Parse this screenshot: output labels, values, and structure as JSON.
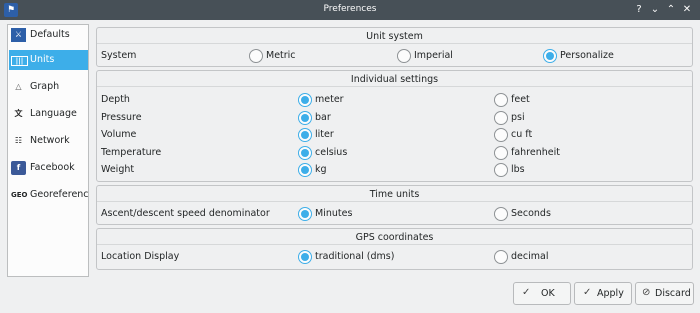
{
  "window": {
    "title": "Preferences",
    "icon": "subsurface-app-icon",
    "controls": [
      "help-icon",
      "minimize-icon",
      "maximize-icon",
      "close-icon"
    ]
  },
  "sidebar": {
    "selected": "Units",
    "items": [
      {
        "label": "Defaults",
        "icon": "diver-icon"
      },
      {
        "label": "Units",
        "icon": "ruler-icon"
      },
      {
        "label": "Graph",
        "icon": "graph-icon"
      },
      {
        "label": "Language",
        "icon": "language-icon"
      },
      {
        "label": "Network",
        "icon": "network-icon"
      },
      {
        "label": "Facebook",
        "icon": "facebook-icon"
      },
      {
        "label": "Georeferenc",
        "icon": "geo-icon",
        "icon_text": "GEO"
      }
    ]
  },
  "unit_system": {
    "title": "Unit system",
    "label": "System",
    "options": [
      "Metric",
      "Imperial",
      "Personalize"
    ],
    "selected": "Personalize"
  },
  "individual": {
    "title": "Individual settings",
    "rows": [
      {
        "label": "Depth",
        "a": "meter",
        "b": "feet",
        "selected": "a"
      },
      {
        "label": "Pressure",
        "a": "bar",
        "b": "psi",
        "selected": "a"
      },
      {
        "label": "Volume",
        "a": "liter",
        "b": "cu ft",
        "selected": "a"
      },
      {
        "label": "Temperature",
        "a": "celsius",
        "b": "fahrenheit",
        "selected": "a"
      },
      {
        "label": "Weight",
        "a": "kg",
        "b": "lbs",
        "selected": "a"
      }
    ]
  },
  "time_units": {
    "title": "Time units",
    "label": "Ascent/descent speed denominator",
    "a": "Minutes",
    "b": "Seconds",
    "selected": "a"
  },
  "gps": {
    "title": "GPS coordinates",
    "label": "Location Display",
    "a": "traditional (dms)",
    "b": "decimal",
    "selected": "a"
  },
  "buttons": {
    "ok": "OK",
    "apply": "Apply",
    "discard": "Discard"
  },
  "colors": {
    "accent": "#3daee9",
    "titlebar": "#475057",
    "window_bg": "#eff0f1"
  }
}
